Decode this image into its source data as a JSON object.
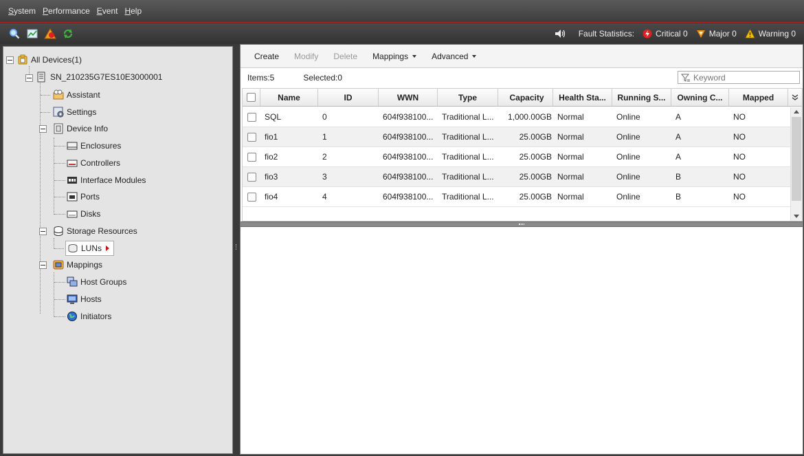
{
  "menu": {
    "items": [
      {
        "first": "S",
        "rest": "ystem"
      },
      {
        "first": "P",
        "rest": "erformance"
      },
      {
        "first": "E",
        "rest": "vent"
      },
      {
        "first": "H",
        "rest": "elp"
      }
    ]
  },
  "toolbar": {
    "icons": [
      "search-icon",
      "monitor-chart-icon",
      "alarm-icon",
      "refresh-icon"
    ]
  },
  "fault_stats": {
    "label": "Fault Statistics:",
    "critical": "Critical 0",
    "major": "Major 0",
    "warning": "Warning 0",
    "colors": {
      "critical": "#e02020",
      "major": "#f08a00",
      "warning": "#f5c400"
    }
  },
  "tree": {
    "root": "All Devices(1)",
    "device": "SN_210235G7ES10E3000001",
    "assistant": "Assistant",
    "settings": "Settings",
    "device_info": "Device Info",
    "enclosures": "Enclosures",
    "controllers": "Controllers",
    "interface_modules": "Interface Modules",
    "ports": "Ports",
    "disks": "Disks",
    "storage_resources": "Storage Resources",
    "luns": "LUNs",
    "mappings": "Mappings",
    "host_groups": "Host Groups",
    "hosts": "Hosts",
    "initiators": "Initiators"
  },
  "actions": {
    "create": "Create",
    "modify": "Modify",
    "delete": "Delete",
    "mappings": "Mappings",
    "advanced": "Advanced"
  },
  "info": {
    "items": "Items:5",
    "selected": "Selected:0",
    "keyword_placeholder": "Keyword"
  },
  "table": {
    "columns": [
      "Name",
      "ID",
      "WWN",
      "Type",
      "Capacity",
      "Health Sta...",
      "Running S...",
      "Owning C...",
      "Mapped"
    ],
    "rows": [
      {
        "name": "SQL",
        "id": "0",
        "wwn": "604f938100...",
        "type": "Traditional L...",
        "capacity": "1,000.00GB",
        "health": "Normal",
        "running": "Online",
        "owning": "A",
        "mapped": "NO"
      },
      {
        "name": "fio1",
        "id": "1",
        "wwn": "604f938100...",
        "type": "Traditional L...",
        "capacity": "25.00GB",
        "health": "Normal",
        "running": "Online",
        "owning": "A",
        "mapped": "NO"
      },
      {
        "name": "fio2",
        "id": "2",
        "wwn": "604f938100...",
        "type": "Traditional L...",
        "capacity": "25.00GB",
        "health": "Normal",
        "running": "Online",
        "owning": "A",
        "mapped": "NO"
      },
      {
        "name": "fio3",
        "id": "3",
        "wwn": "604f938100...",
        "type": "Traditional L...",
        "capacity": "25.00GB",
        "health": "Normal",
        "running": "Online",
        "owning": "B",
        "mapped": "NO"
      },
      {
        "name": "fio4",
        "id": "4",
        "wwn": "604f938100...",
        "type": "Traditional L...",
        "capacity": "25.00GB",
        "health": "Normal",
        "running": "Online",
        "owning": "B",
        "mapped": "NO"
      }
    ]
  }
}
